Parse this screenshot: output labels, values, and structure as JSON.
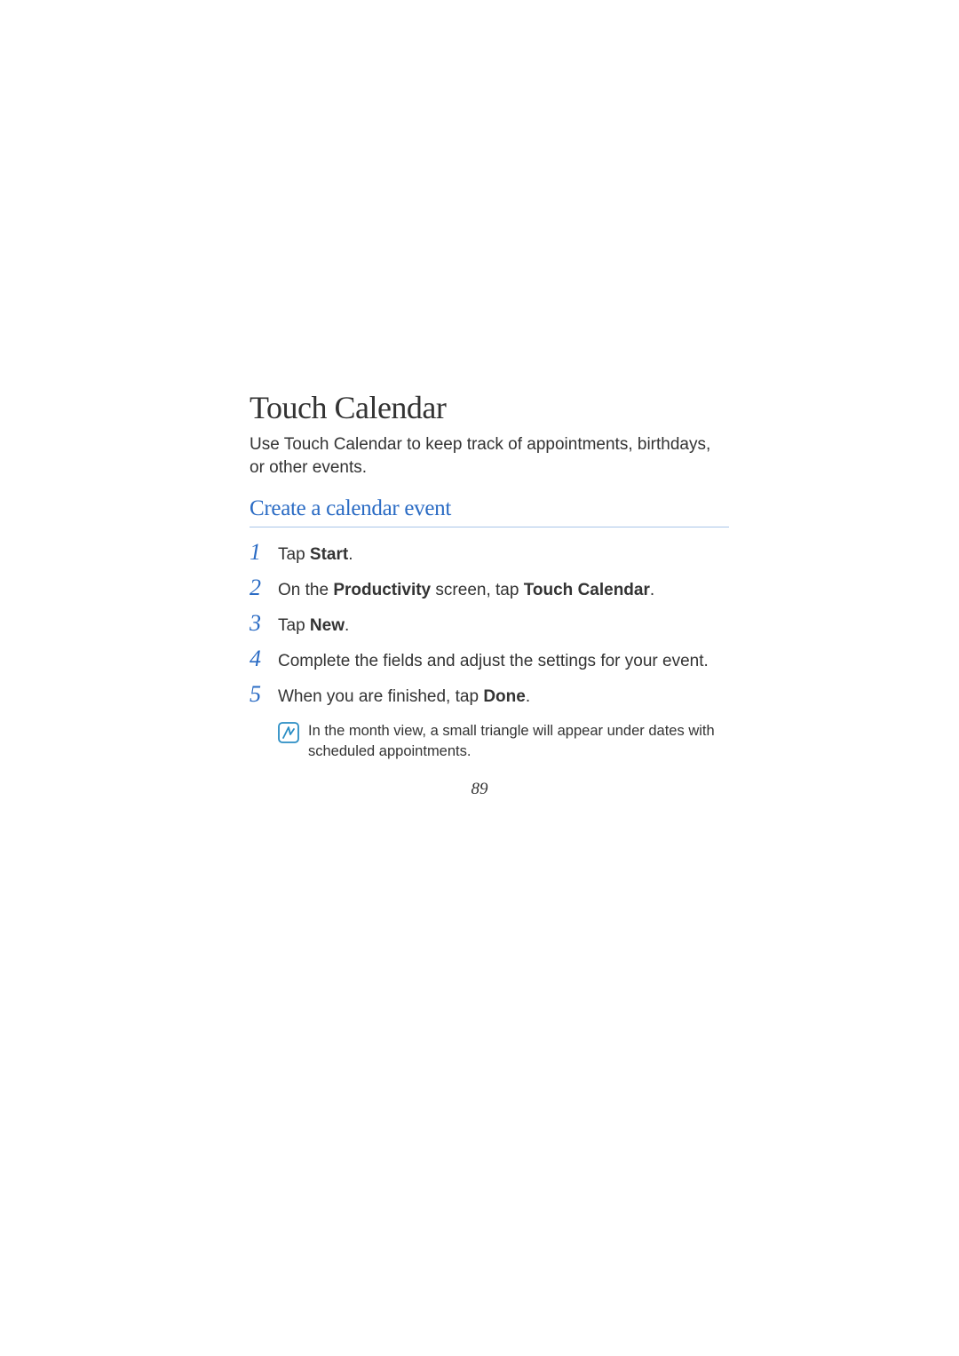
{
  "heading": "Touch Calendar",
  "intro": "Use Touch Calendar to keep track of appointments, birthdays, or other events.",
  "subheading": "Create a calendar event",
  "steps": [
    {
      "number": "1",
      "parts": [
        {
          "text": "Tap ",
          "bold": false
        },
        {
          "text": "Start",
          "bold": true
        },
        {
          "text": ".",
          "bold": false
        }
      ]
    },
    {
      "number": "2",
      "parts": [
        {
          "text": "On the ",
          "bold": false
        },
        {
          "text": "Productivity",
          "bold": true
        },
        {
          "text": " screen, tap ",
          "bold": false
        },
        {
          "text": "Touch Calendar",
          "bold": true
        },
        {
          "text": ".",
          "bold": false
        }
      ]
    },
    {
      "number": "3",
      "parts": [
        {
          "text": "Tap ",
          "bold": false
        },
        {
          "text": "New",
          "bold": true
        },
        {
          "text": ".",
          "bold": false
        }
      ]
    },
    {
      "number": "4",
      "parts": [
        {
          "text": "Complete the fields and adjust the settings for your event.",
          "bold": false
        }
      ]
    },
    {
      "number": "5",
      "parts": [
        {
          "text": "When you are finished, tap ",
          "bold": false
        },
        {
          "text": "Done",
          "bold": true
        },
        {
          "text": ".",
          "bold": false
        }
      ]
    }
  ],
  "note": "In the month view, a small triangle will appear under dates with scheduled appointments.",
  "page_number": "89"
}
